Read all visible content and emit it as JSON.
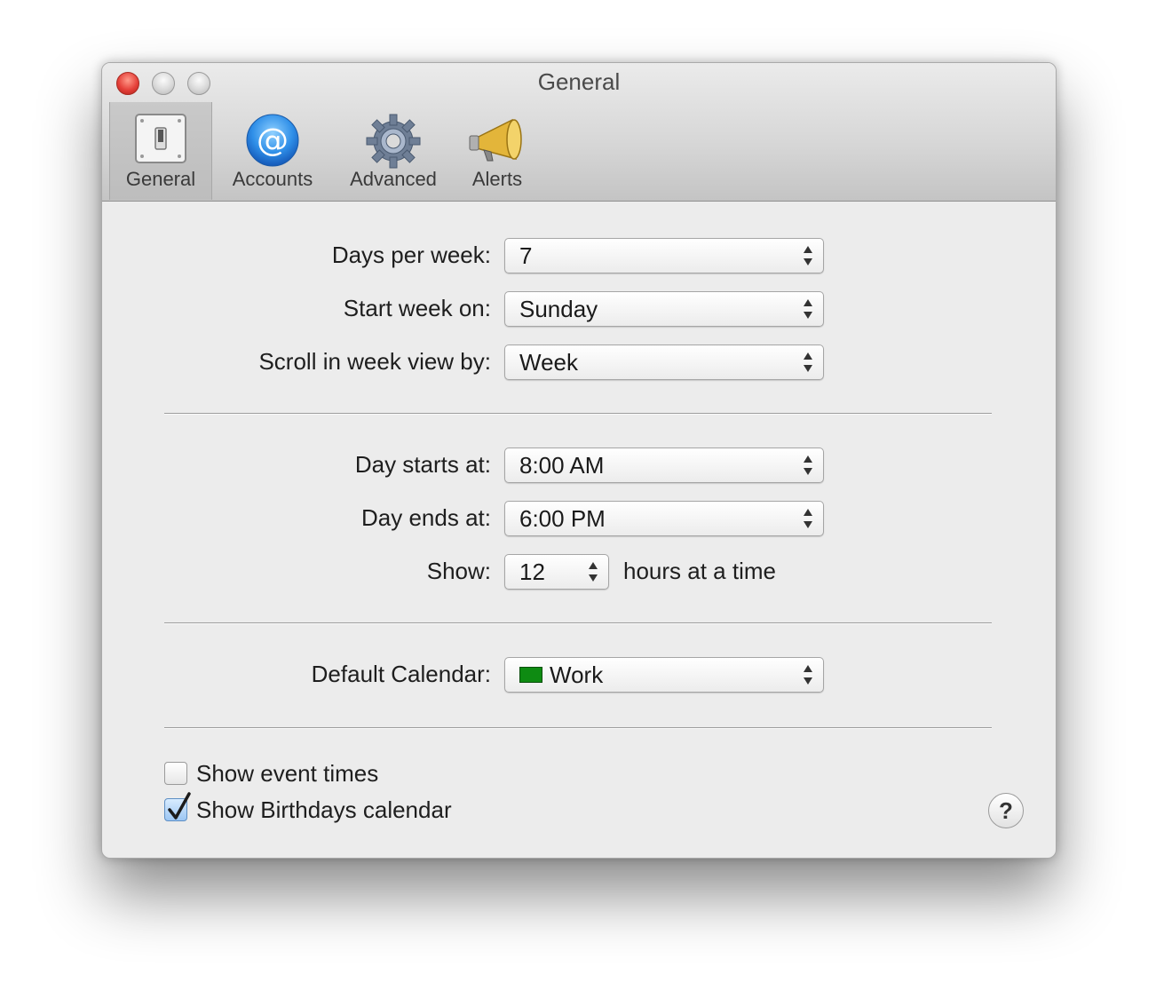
{
  "window": {
    "title": "General"
  },
  "toolbar": {
    "tabs": [
      {
        "label": "General",
        "icon": "switch-icon",
        "selected": true
      },
      {
        "label": "Accounts",
        "icon": "at-sign-icon",
        "selected": false
      },
      {
        "label": "Advanced",
        "icon": "gear-icon",
        "selected": false
      },
      {
        "label": "Alerts",
        "icon": "megaphone-icon",
        "selected": false
      }
    ]
  },
  "week": {
    "days_per_week": {
      "label": "Days per week:",
      "value": "7"
    },
    "start_week_on": {
      "label": "Start week on:",
      "value": "Sunday"
    },
    "scroll_by": {
      "label": "Scroll in week view by:",
      "value": "Week"
    }
  },
  "day": {
    "starts_at": {
      "label": "Day starts at:",
      "value": "8:00 AM"
    },
    "ends_at": {
      "label": "Day ends at:",
      "value": "6:00 PM"
    },
    "show": {
      "label": "Show:",
      "value": "12",
      "suffix": "hours at a time"
    }
  },
  "calendar": {
    "default": {
      "label": "Default Calendar:",
      "value": "Work",
      "color": "#0e8b12"
    }
  },
  "options": {
    "show_event_times": {
      "label": "Show event times",
      "checked": false
    },
    "show_birthdays": {
      "label": "Show Birthdays calendar",
      "checked": true
    }
  },
  "help": {
    "symbol": "?"
  }
}
